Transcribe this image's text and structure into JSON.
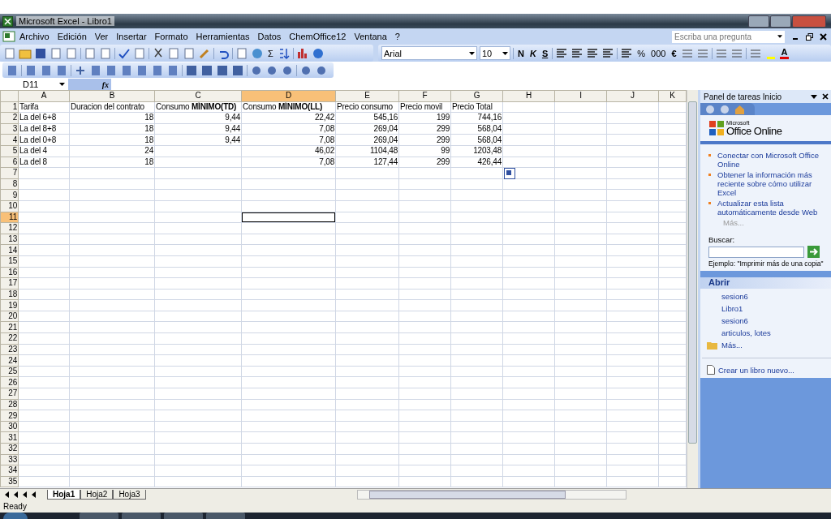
{
  "window": {
    "title": "Microsoft Excel - Libro1"
  },
  "menu": [
    "Archivo",
    "Edición",
    "Ver",
    "Insertar",
    "Formato",
    "Herramientas",
    "Datos",
    "ChemOffice12",
    "Ventana",
    "?"
  ],
  "help_search": {
    "placeholder": "Escriba una pregunta"
  },
  "toolbar": {
    "sum": "Σ",
    "font": "Arial",
    "size": "10",
    "bold": "N",
    "italic": "K",
    "underline": "S",
    "percent": "%",
    "thousands": "000",
    "euro": "€",
    "font_color": "A"
  },
  "name_box": "D11",
  "formula_label": "fx",
  "columns": [
    {
      "label": "A",
      "selected": false
    },
    {
      "label": "B",
      "selected": false
    },
    {
      "label": "C",
      "selected": false
    },
    {
      "label": "D",
      "selected": true
    },
    {
      "label": "E",
      "selected": false
    },
    {
      "label": "F",
      "selected": false
    },
    {
      "label": "G",
      "selected": false
    },
    {
      "label": "H",
      "selected": false
    },
    {
      "label": "I",
      "selected": false
    },
    {
      "label": "J",
      "selected": false
    },
    {
      "label": "K",
      "selected": false
    }
  ],
  "rows": [
    {
      "label": "1",
      "selected": false,
      "kind": "text",
      "cells": [
        "Tarifa",
        "Duracion del contrato",
        "Consumo **MÍNIMO(TD)**",
        "Consumo **MÍNIMO(LL)**",
        "Precio consumo",
        "Precio movil",
        "Precio Total"
      ]
    },
    {
      "label": "2",
      "selected": false,
      "kind": "numeric",
      "cells": [
        "La del 6+8",
        "18",
        "9,44",
        "22,42",
        "545,16",
        "199",
        "744,16"
      ]
    },
    {
      "label": "3",
      "selected": false,
      "kind": "numeric",
      "cells": [
        "La del 8+8",
        "18",
        "9,44",
        "7,08",
        "269,04",
        "299",
        "568,04"
      ]
    },
    {
      "label": "4",
      "selected": false,
      "kind": "numeric",
      "cells": [
        "La del 0+8",
        "18",
        "9,44",
        "7,08",
        "269,04",
        "299",
        "568,04"
      ]
    },
    {
      "label": "5",
      "selected": false,
      "kind": "numeric",
      "cells": [
        "La del 4",
        "24",
        null,
        "46,02",
        "1104,48",
        "99",
        "1203,48"
      ]
    },
    {
      "label": "6",
      "selected": false,
      "kind": "numeric",
      "cells": [
        "La del 8",
        "18",
        null,
        "7,08",
        "127,44",
        "299",
        "426,44"
      ]
    },
    {
      "label": "7",
      "selected": false
    },
    {
      "label": "8",
      "selected": false
    },
    {
      "label": "9",
      "selected": false
    },
    {
      "label": "10",
      "selected": false
    },
    {
      "label": "11",
      "selected": true
    },
    {
      "label": "12",
      "selected": false
    },
    {
      "label": "13",
      "selected": false
    },
    {
      "label": "14",
      "selected": false
    },
    {
      "label": "15",
      "selected": false
    },
    {
      "label": "16",
      "selected": false
    },
    {
      "label": "17",
      "selected": false
    },
    {
      "label": "18",
      "selected": false
    },
    {
      "label": "19",
      "selected": false
    },
    {
      "label": "20",
      "selected": false
    },
    {
      "label": "21",
      "selected": false
    },
    {
      "label": "22",
      "selected": false
    },
    {
      "label": "23",
      "selected": false
    },
    {
      "label": "24",
      "selected": false
    },
    {
      "label": "25",
      "selected": false
    },
    {
      "label": "26",
      "selected": false
    },
    {
      "label": "27",
      "selected": false
    },
    {
      "label": "28",
      "selected": false
    },
    {
      "label": "29",
      "selected": false
    },
    {
      "label": "30",
      "selected": false
    },
    {
      "label": "31",
      "selected": false
    },
    {
      "label": "32",
      "selected": false
    },
    {
      "label": "33",
      "selected": false
    },
    {
      "label": "34",
      "selected": false
    },
    {
      "label": "35",
      "selected": false
    }
  ],
  "sheet_tabs": [
    {
      "label": "Hoja1",
      "selected": true
    },
    {
      "label": "Hoja2",
      "selected": false
    },
    {
      "label": "Hoja3",
      "selected": false
    }
  ],
  "status_bar": "Ready",
  "task_pane": {
    "title": "Panel de tareas Inicio",
    "logo_small": "Microsoft",
    "logo": "Office Online",
    "links": [
      "Conectar con Microsoft Office Online",
      "Obtener la información más reciente sobre cómo utilizar Excel",
      "Actualizar esta lista automáticamente desde Web"
    ],
    "more_disabled": "Más...",
    "search_label": "Buscar:",
    "example": "Ejemplo:  \"Imprimir más de una copia\"",
    "open_heading": "Abrir",
    "files": [
      "sesion6",
      "Libro1",
      "sesion6",
      "articulos, lotes"
    ],
    "open_more": "Más...",
    "new_workbook": "Crear un libro nuevo..."
  }
}
